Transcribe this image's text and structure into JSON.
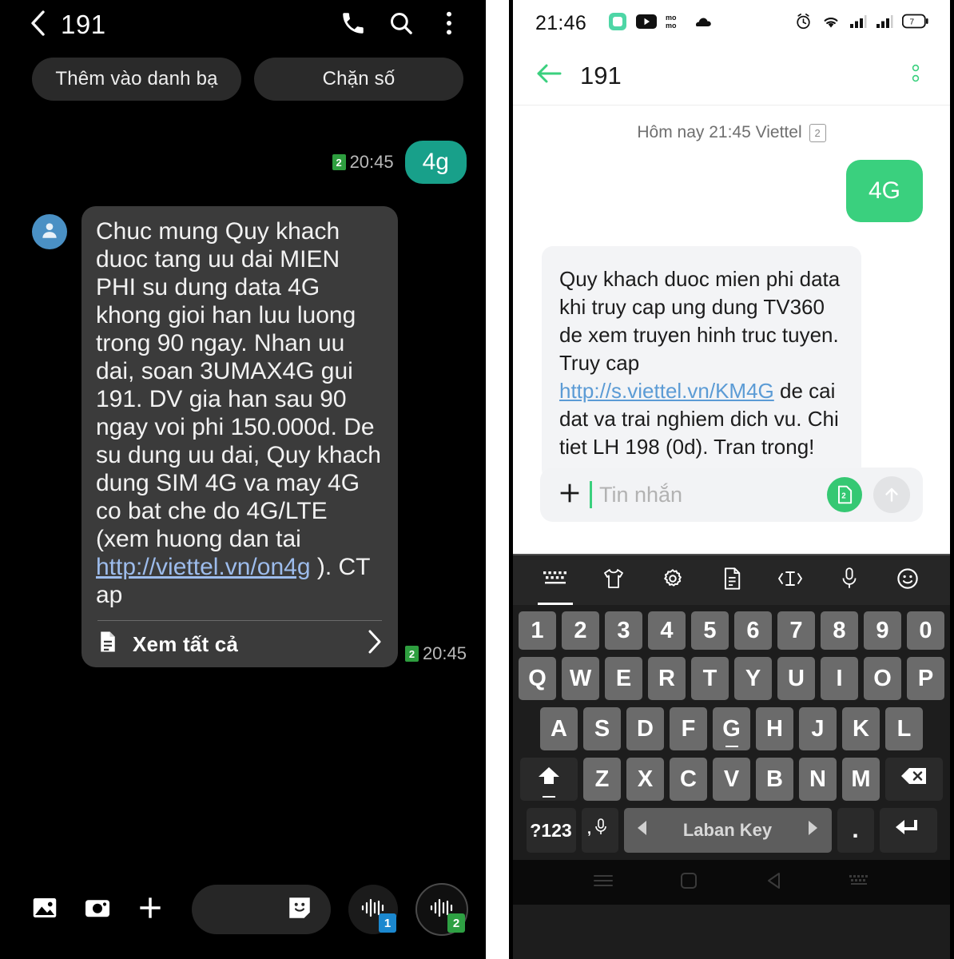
{
  "left_phone": {
    "header": {
      "back_icon": "chevron-left-icon",
      "title": "191",
      "call_icon": "phone-icon",
      "search_icon": "search-icon",
      "more_icon": "more-vertical-icon"
    },
    "chips": [
      {
        "label": "Thêm vào danh bạ"
      },
      {
        "label": "Chặn số"
      }
    ],
    "messages": [
      {
        "direction": "outgoing",
        "text": "4g",
        "time": "20:45",
        "sim": "2"
      },
      {
        "direction": "incoming",
        "text_head": "Chuc mung Quy khach duoc tang uu dai MIEN PHI su dung data 4G khong gioi han luu luong trong 90 ngay. Nhan uu dai, soan 3UMAX4G gui 191. DV gia han sau 90 ngay voi phi 150.000d. De su dung uu dai, Quy khach dung SIM 4G va may 4G co bat che do 4G/LTE (xem huong dan tai ",
        "link": "http://viettel.vn/on4g",
        "text_tail": " ). CT ap",
        "view_all_label": "Xem tất cả",
        "view_all_icon": "document-icon",
        "chevron_icon": "chevron-right-icon",
        "time": "20:45",
        "sim": "2",
        "avatar_icon": "person-icon"
      }
    ],
    "bottom_bar": {
      "gallery_icon": "image-icon",
      "camera_icon": "camera-icon",
      "plus_icon": "plus-icon",
      "input_placeholder": "",
      "sticker_icon": "sticker-icon",
      "send_sim1_label": "1",
      "send_sim2_label": "2",
      "send_icon": "voice-wave-icon"
    }
  },
  "right_phone": {
    "status_bar": {
      "clock": "21:46",
      "icons_left": [
        "app-green-icon",
        "youtube-icon",
        "momo-icon",
        "cloud-icon"
      ],
      "icons_right": [
        "alarm-icon",
        "wifi-icon",
        "signal-icon",
        "signal-icon",
        "battery-icon"
      ],
      "battery_level": "7"
    },
    "header": {
      "back_icon": "arrow-left-icon",
      "title": "191",
      "more_icon": "more-vertical-icon"
    },
    "date_separator": {
      "text": "Hôm nay 21:45  Viettel",
      "sim": "2"
    },
    "messages": [
      {
        "direction": "outgoing",
        "text": "4G"
      },
      {
        "direction": "incoming",
        "text_head": "Quy khach duoc mien phi data khi truy cap ung dung TV360 de xem truyen hinh truc tuyen. Truy cap ",
        "link": "http://s.viettel.vn/KM4G",
        "text_tail": " de cai dat va trai nghiem dich vu. Chi tiet LH 198 (0d). Tran trong!"
      }
    ],
    "input_bar": {
      "plus_icon": "plus-icon",
      "placeholder": "Tin nhắn",
      "sim_label": "2",
      "send_icon": "arrow-up-icon"
    },
    "keyboard": {
      "toolbar": [
        {
          "icon": "keyboard-icon",
          "active": true
        },
        {
          "icon": "tshirt-theme-icon",
          "active": false
        },
        {
          "icon": "gear-icon",
          "active": false
        },
        {
          "icon": "clipboard-icon",
          "active": false
        },
        {
          "icon": "cursor-move-icon",
          "active": false
        },
        {
          "icon": "microphone-icon",
          "active": false
        },
        {
          "icon": "emoji-icon",
          "active": false
        }
      ],
      "row_digits": [
        "1",
        "2",
        "3",
        "4",
        "5",
        "6",
        "7",
        "8",
        "9",
        "0"
      ],
      "row_top": [
        "Q",
        "W",
        "E",
        "R",
        "T",
        "Y",
        "U",
        "I",
        "O",
        "P"
      ],
      "row_home": [
        "A",
        "S",
        "D",
        "F",
        "G",
        "H",
        "J",
        "K",
        "L"
      ],
      "row_bottom": [
        "Z",
        "X",
        "C",
        "V",
        "B",
        "N",
        "M"
      ],
      "shift_icon": "shift-up-icon",
      "backspace_icon": "backspace-icon",
      "symbols_label": "?123",
      "mic_comma_icon": "comma-mic-icon",
      "space_label": "Laban Key",
      "space_prev_icon": "triangle-left-icon",
      "space_next_icon": "triangle-right-icon",
      "period_label": ".",
      "enter_icon": "enter-icon"
    },
    "nav_bar": {
      "recents_icon": "menu-icon",
      "home_icon": "home-square-icon",
      "back_icon": "triangle-back-icon",
      "keyboard_icon": "keyboard-dismiss-icon"
    }
  },
  "colors": {
    "left_accent": "#18a08a",
    "right_accent": "#3ad07e",
    "link": "#9dbcec",
    "link_right": "#5b9bd5",
    "sim1": "#1b88cf",
    "sim2": "#2ea043"
  }
}
